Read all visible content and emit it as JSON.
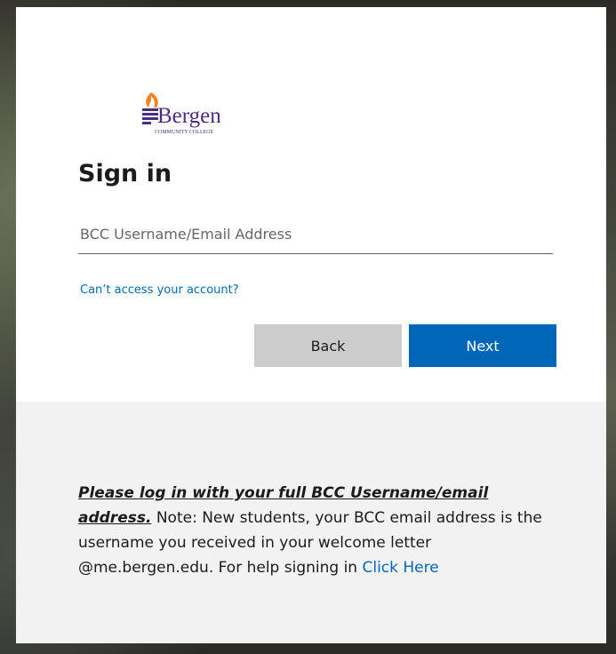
{
  "logo": {
    "name": "Bergen",
    "subtitle": "COMMUNITY COLLEGE",
    "colors": {
      "flame": "#f5821f",
      "text": "#4b2c83"
    }
  },
  "signin": {
    "title": "Sign in",
    "username": {
      "placeholder": "BCC Username/Email Address",
      "value": ""
    },
    "cant_access_link": "Can’t access your account?",
    "back_label": "Back",
    "next_label": "Next"
  },
  "footer": {
    "emphasis": "Please log in with your full BCC Username/email address.",
    "body": " Note: New students, your BCC email address is the username you received in your welcome letter @me.bergen.edu. For help signing in ",
    "help_link": "Click Here"
  },
  "colors": {
    "accent": "#0067b8",
    "back_button": "#cccccc",
    "footer_bg": "#f2f2f2"
  }
}
